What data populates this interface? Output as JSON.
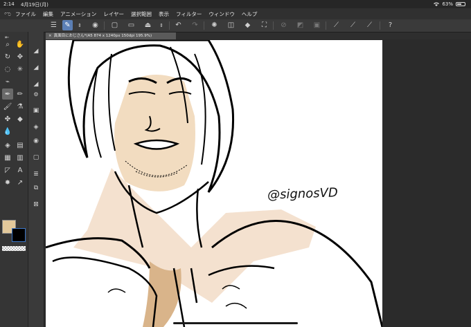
{
  "status": {
    "time": "2:14",
    "date": "4月19日(月)",
    "battery": "63%",
    "battery_level": 0.63
  },
  "menu": {
    "items": [
      "ファイル",
      "編集",
      "アニメーション",
      "レイヤー",
      "選択範囲",
      "表示",
      "フィルター",
      "ウィンドウ",
      "ヘルプ"
    ]
  },
  "document": {
    "tab_title": "真面目におじさん*(A5 874 x 1240px 150dpi 195.9%)"
  },
  "artwork": {
    "signature": "@signosVD"
  },
  "colors": {
    "main_color": "#e2c89b",
    "sub_color": "#000000",
    "accent": "#5b7fb5"
  },
  "icons": {
    "toolbar": [
      "menu-icon",
      "brush-settings-icon",
      "stepper-icon",
      "tool-property-icon",
      "new-canvas-icon",
      "open-folder-icon",
      "save-icon",
      "stepper-icon",
      "undo-icon",
      "redo-icon",
      "clear-icon",
      "fill-icon",
      "transform-icon",
      "deselect-icon",
      "invert-selection-icon",
      "select-all-icon",
      "ruler-icon",
      "snap-icon",
      "special-ruler-icon",
      "help-icon"
    ]
  }
}
